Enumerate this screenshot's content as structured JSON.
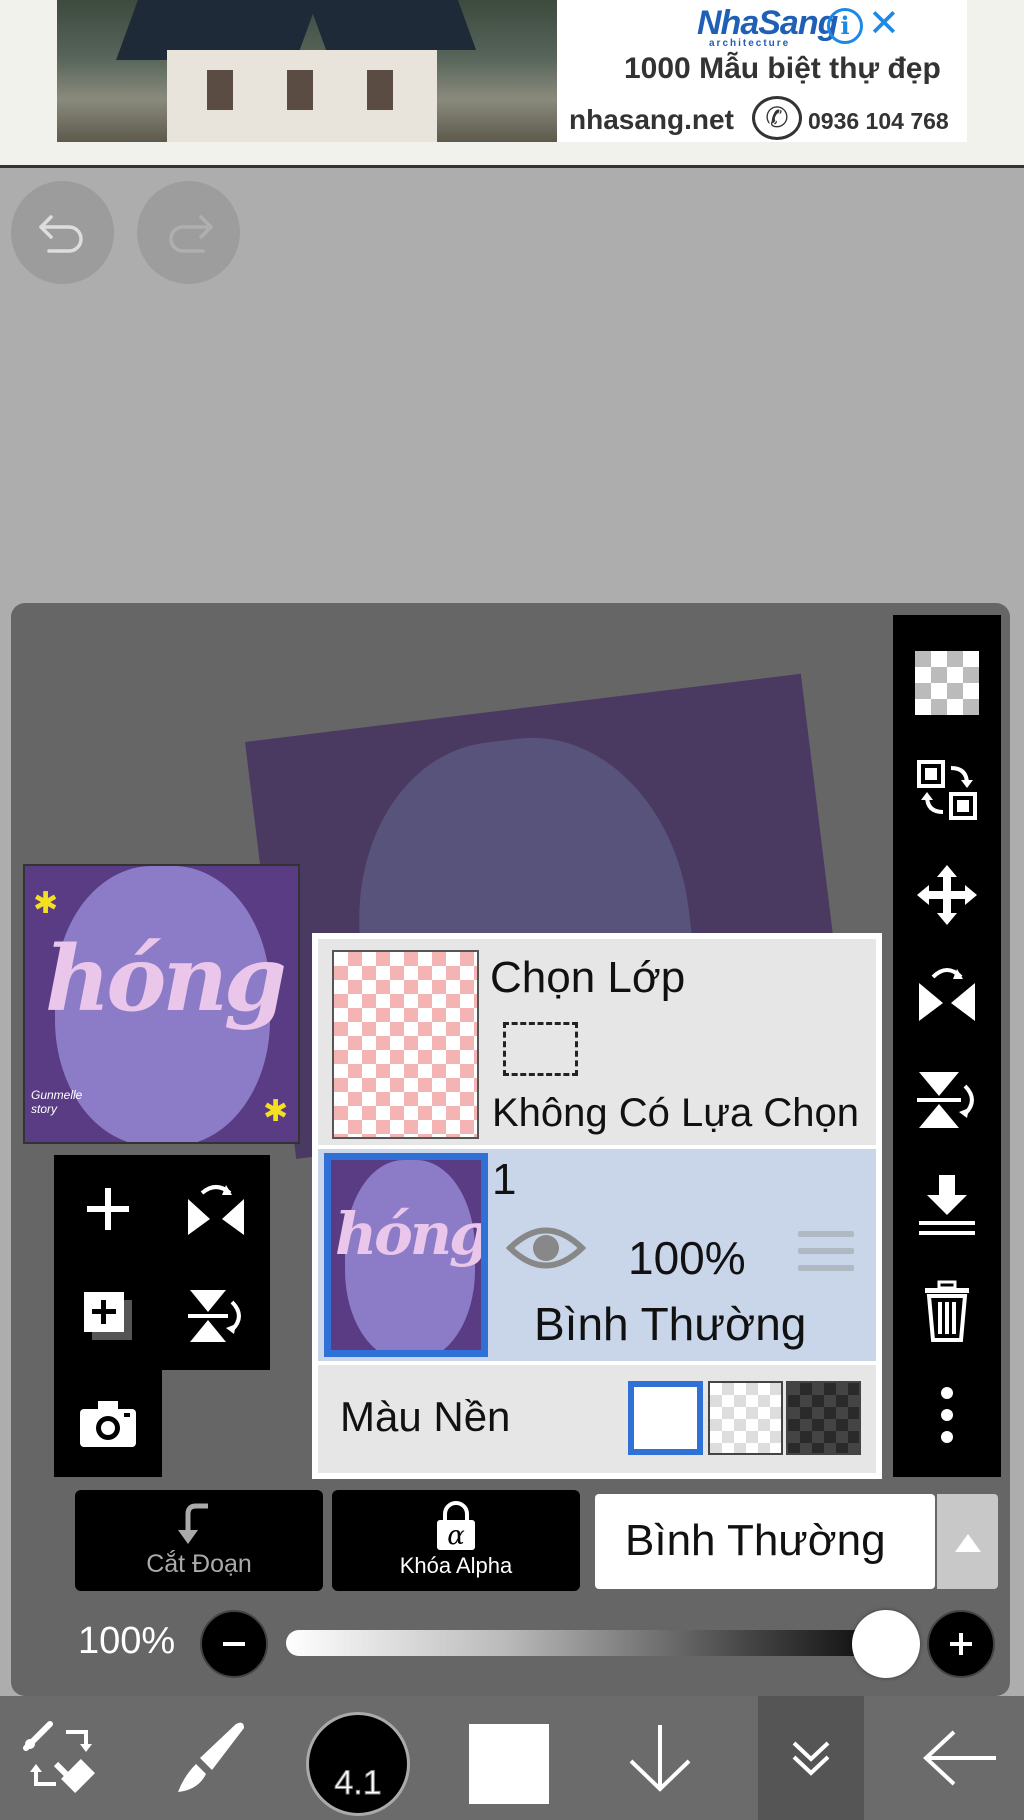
{
  "ad": {
    "brand": "NhaSang",
    "brand_sub": "architecture",
    "headline": "1000 Mẫu biệt thự đẹp",
    "url": "nhasang.net",
    "phone": "0936 104 768",
    "info_symbol": "i",
    "close_symbol": "✕",
    "accent": "#1e88e5"
  },
  "history": {
    "undo_icon": "undo-icon",
    "redo_icon": "redo-icon"
  },
  "thumbnail": {
    "art_text": "hóng",
    "signature": "Gunmelle\nstory"
  },
  "layers": {
    "selection": {
      "title": "Chọn Lớp",
      "status": "Không Có Lựa Chọn"
    },
    "layer1": {
      "name": "1",
      "art_text": "hóng",
      "opacity": "100%",
      "blend": "Bình Thường",
      "visible": true,
      "selected_color": "#2f71d6"
    },
    "background": {
      "label": "Màu Nền",
      "options": [
        "white",
        "checker",
        "dark-checker"
      ],
      "selected": "white"
    }
  },
  "actions": {
    "clipping": "Cắt Đoạn",
    "alpha_lock": "Khóa Alpha",
    "alpha_symbol": "α",
    "blend_mode": "Bình Thường"
  },
  "opacity": {
    "label": "100%",
    "value": 1.0,
    "minus": "−",
    "plus": "+"
  },
  "toolbar": {
    "brush_size": "4.1",
    "color": "#ffffff",
    "items": [
      "transform-eraser-icon",
      "brush-icon",
      "brush-size",
      "color-swatch",
      "arrow-down-icon",
      "collapse-icon",
      "back-arrow-icon"
    ]
  },
  "right_toolbar": {
    "items": [
      "transparency-icon",
      "copy-layer-icon",
      "move-icon",
      "flip-horizontal-icon",
      "flip-vertical-icon",
      "merge-down-icon",
      "trash-icon",
      "more-icon"
    ]
  },
  "left_tools": {
    "items": [
      "add-layer-icon",
      "flip-layer-h-icon",
      "duplicate-layer-icon",
      "flip-layer-v-icon",
      "camera-icon"
    ]
  }
}
